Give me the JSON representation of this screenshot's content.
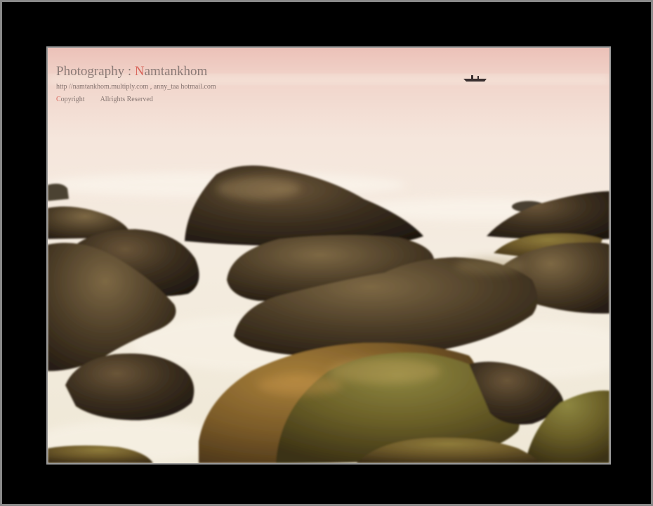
{
  "watermark": {
    "title_prefix": "Photography : ",
    "title_accent": "N",
    "title_rest": "amtankhom",
    "contact": "http //namtankhom.multiply.com , anny_taa    hotmail.com",
    "copyright_accent": "C",
    "copyright_rest": "opyright",
    "rights": "Allrights Reserved"
  },
  "scene": {
    "subject": "long-exposure seascape with rounded mossy boulders in misty water",
    "elements": [
      "pink-sky",
      "misty-sea",
      "fishing-boat",
      "boulders"
    ],
    "colors": {
      "sky": "#efc9c0",
      "mist": "#f4ece0",
      "frame": "#000000",
      "frame_border": "#8a8a8a",
      "rock_dark": "#2e2418",
      "rock_moss": "#7a6a2a",
      "accent_text": "#d9665c"
    }
  }
}
